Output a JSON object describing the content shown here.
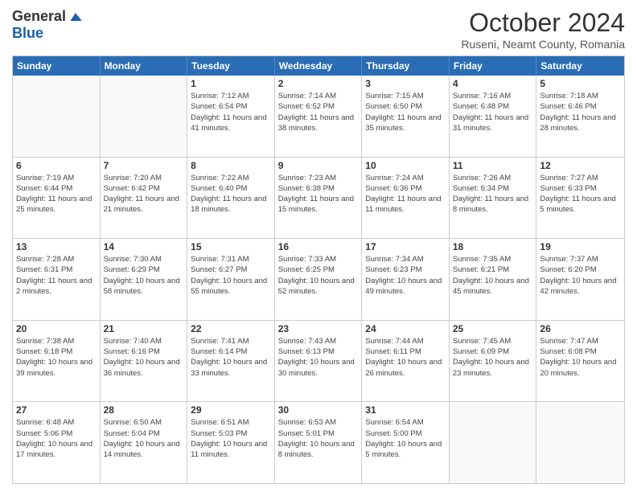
{
  "header": {
    "logo_general": "General",
    "logo_blue": "Blue",
    "month_title": "October 2024",
    "subtitle": "Ruseni, Neamt County, Romania"
  },
  "days_of_week": [
    "Sunday",
    "Monday",
    "Tuesday",
    "Wednesday",
    "Thursday",
    "Friday",
    "Saturday"
  ],
  "weeks": [
    [
      {
        "day": "",
        "info": ""
      },
      {
        "day": "",
        "info": ""
      },
      {
        "day": "1",
        "info": "Sunrise: 7:12 AM\nSunset: 6:54 PM\nDaylight: 11 hours and 41 minutes."
      },
      {
        "day": "2",
        "info": "Sunrise: 7:14 AM\nSunset: 6:52 PM\nDaylight: 11 hours and 38 minutes."
      },
      {
        "day": "3",
        "info": "Sunrise: 7:15 AM\nSunset: 6:50 PM\nDaylight: 11 hours and 35 minutes."
      },
      {
        "day": "4",
        "info": "Sunrise: 7:16 AM\nSunset: 6:48 PM\nDaylight: 11 hours and 31 minutes."
      },
      {
        "day": "5",
        "info": "Sunrise: 7:18 AM\nSunset: 6:46 PM\nDaylight: 11 hours and 28 minutes."
      }
    ],
    [
      {
        "day": "6",
        "info": "Sunrise: 7:19 AM\nSunset: 6:44 PM\nDaylight: 11 hours and 25 minutes."
      },
      {
        "day": "7",
        "info": "Sunrise: 7:20 AM\nSunset: 6:42 PM\nDaylight: 11 hours and 21 minutes."
      },
      {
        "day": "8",
        "info": "Sunrise: 7:22 AM\nSunset: 6:40 PM\nDaylight: 11 hours and 18 minutes."
      },
      {
        "day": "9",
        "info": "Sunrise: 7:23 AM\nSunset: 6:38 PM\nDaylight: 11 hours and 15 minutes."
      },
      {
        "day": "10",
        "info": "Sunrise: 7:24 AM\nSunset: 6:36 PM\nDaylight: 11 hours and 11 minutes."
      },
      {
        "day": "11",
        "info": "Sunrise: 7:26 AM\nSunset: 6:34 PM\nDaylight: 11 hours and 8 minutes."
      },
      {
        "day": "12",
        "info": "Sunrise: 7:27 AM\nSunset: 6:33 PM\nDaylight: 11 hours and 5 minutes."
      }
    ],
    [
      {
        "day": "13",
        "info": "Sunrise: 7:28 AM\nSunset: 6:31 PM\nDaylight: 11 hours and 2 minutes."
      },
      {
        "day": "14",
        "info": "Sunrise: 7:30 AM\nSunset: 6:29 PM\nDaylight: 10 hours and 58 minutes."
      },
      {
        "day": "15",
        "info": "Sunrise: 7:31 AM\nSunset: 6:27 PM\nDaylight: 10 hours and 55 minutes."
      },
      {
        "day": "16",
        "info": "Sunrise: 7:33 AM\nSunset: 6:25 PM\nDaylight: 10 hours and 52 minutes."
      },
      {
        "day": "17",
        "info": "Sunrise: 7:34 AM\nSunset: 6:23 PM\nDaylight: 10 hours and 49 minutes."
      },
      {
        "day": "18",
        "info": "Sunrise: 7:35 AM\nSunset: 6:21 PM\nDaylight: 10 hours and 45 minutes."
      },
      {
        "day": "19",
        "info": "Sunrise: 7:37 AM\nSunset: 6:20 PM\nDaylight: 10 hours and 42 minutes."
      }
    ],
    [
      {
        "day": "20",
        "info": "Sunrise: 7:38 AM\nSunset: 6:18 PM\nDaylight: 10 hours and 39 minutes."
      },
      {
        "day": "21",
        "info": "Sunrise: 7:40 AM\nSunset: 6:16 PM\nDaylight: 10 hours and 36 minutes."
      },
      {
        "day": "22",
        "info": "Sunrise: 7:41 AM\nSunset: 6:14 PM\nDaylight: 10 hours and 33 minutes."
      },
      {
        "day": "23",
        "info": "Sunrise: 7:43 AM\nSunset: 6:13 PM\nDaylight: 10 hours and 30 minutes."
      },
      {
        "day": "24",
        "info": "Sunrise: 7:44 AM\nSunset: 6:11 PM\nDaylight: 10 hours and 26 minutes."
      },
      {
        "day": "25",
        "info": "Sunrise: 7:45 AM\nSunset: 6:09 PM\nDaylight: 10 hours and 23 minutes."
      },
      {
        "day": "26",
        "info": "Sunrise: 7:47 AM\nSunset: 6:08 PM\nDaylight: 10 hours and 20 minutes."
      }
    ],
    [
      {
        "day": "27",
        "info": "Sunrise: 6:48 AM\nSunset: 5:06 PM\nDaylight: 10 hours and 17 minutes."
      },
      {
        "day": "28",
        "info": "Sunrise: 6:50 AM\nSunset: 5:04 PM\nDaylight: 10 hours and 14 minutes."
      },
      {
        "day": "29",
        "info": "Sunrise: 6:51 AM\nSunset: 5:03 PM\nDaylight: 10 hours and 11 minutes."
      },
      {
        "day": "30",
        "info": "Sunrise: 6:53 AM\nSunset: 5:01 PM\nDaylight: 10 hours and 8 minutes."
      },
      {
        "day": "31",
        "info": "Sunrise: 6:54 AM\nSunset: 5:00 PM\nDaylight: 10 hours and 5 minutes."
      },
      {
        "day": "",
        "info": ""
      },
      {
        "day": "",
        "info": ""
      }
    ]
  ]
}
